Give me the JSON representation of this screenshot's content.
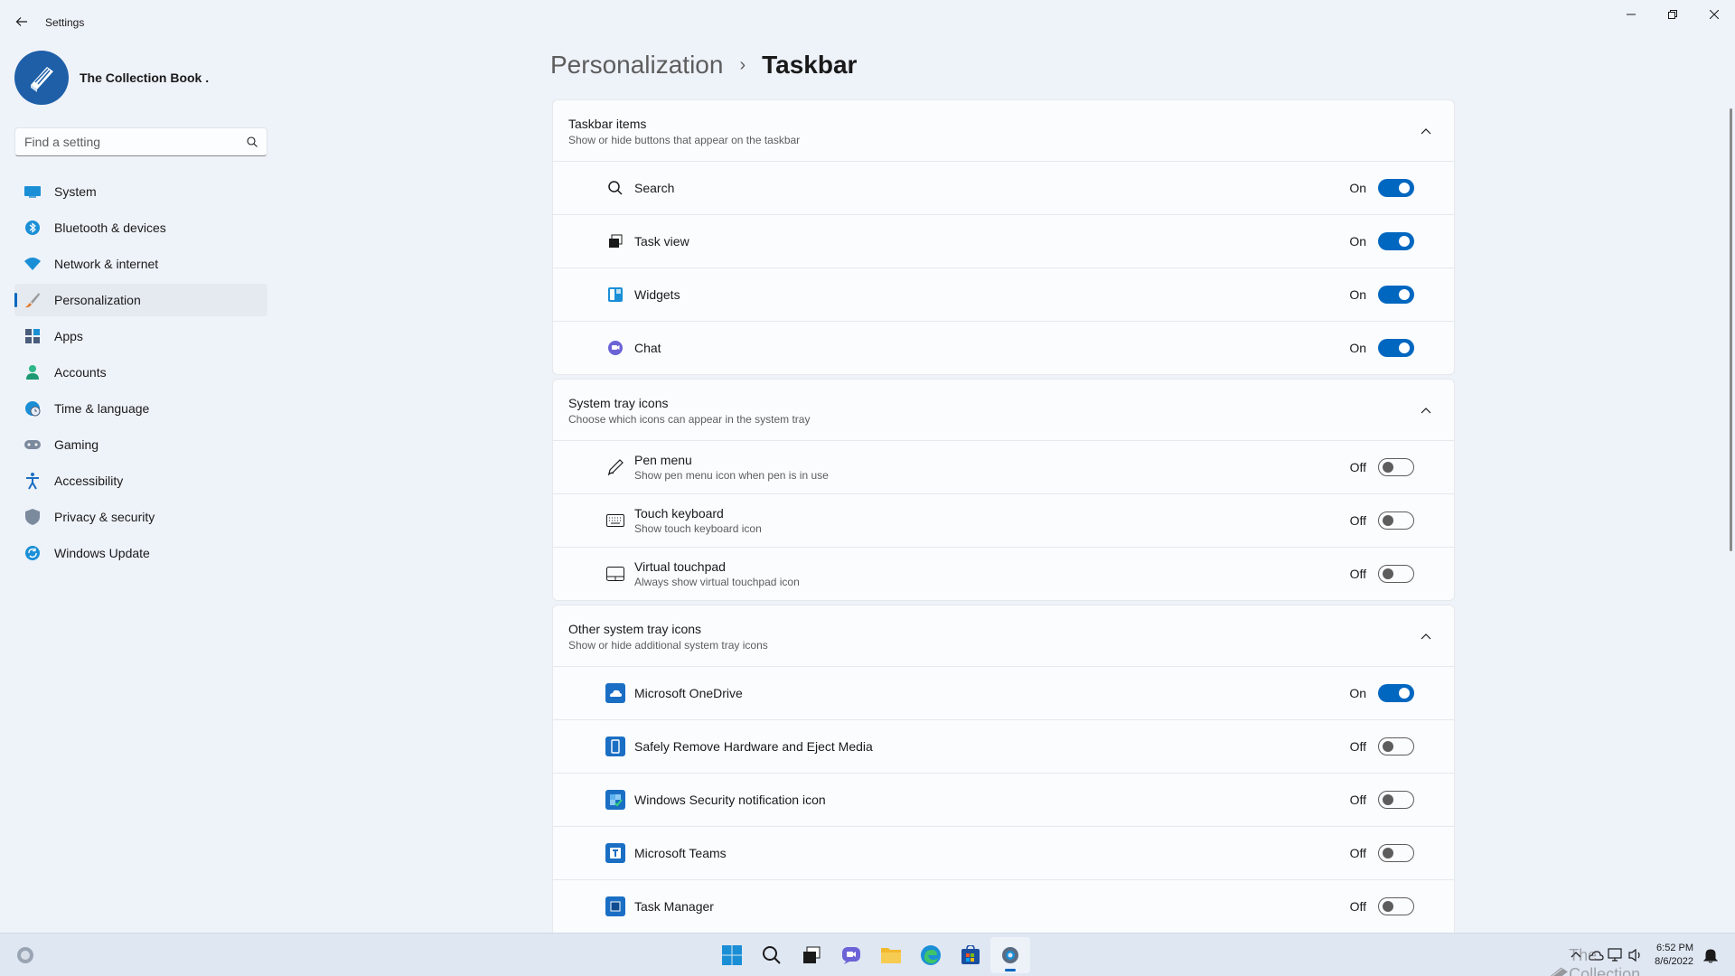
{
  "window": {
    "title": "Settings"
  },
  "profile": {
    "name": "The Collection Book ."
  },
  "search": {
    "placeholder": "Find a setting"
  },
  "sidebar": {
    "items": [
      {
        "label": "System",
        "icon": "monitor-icon"
      },
      {
        "label": "Bluetooth & devices",
        "icon": "bluetooth-icon"
      },
      {
        "label": "Network & internet",
        "icon": "wifi-icon"
      },
      {
        "label": "Personalization",
        "icon": "brush-icon",
        "active": true
      },
      {
        "label": "Apps",
        "icon": "apps-icon"
      },
      {
        "label": "Accounts",
        "icon": "person-icon"
      },
      {
        "label": "Time & language",
        "icon": "globe-clock-icon"
      },
      {
        "label": "Gaming",
        "icon": "gamepad-icon"
      },
      {
        "label": "Accessibility",
        "icon": "accessibility-icon"
      },
      {
        "label": "Privacy & security",
        "icon": "shield-icon"
      },
      {
        "label": "Windows Update",
        "icon": "update-icon"
      }
    ]
  },
  "breadcrumb": {
    "parent": "Personalization",
    "separator": "›",
    "current": "Taskbar"
  },
  "sections": [
    {
      "title": "Taskbar items",
      "subtitle": "Show or hide buttons that appear on the taskbar",
      "rows": [
        {
          "label": "Search",
          "desc": "",
          "state": "On",
          "on": true,
          "icon": "search-icon"
        },
        {
          "label": "Task view",
          "desc": "",
          "state": "On",
          "on": true,
          "icon": "task-view-icon"
        },
        {
          "label": "Widgets",
          "desc": "",
          "state": "On",
          "on": true,
          "icon": "widgets-icon"
        },
        {
          "label": "Chat",
          "desc": "",
          "state": "On",
          "on": true,
          "icon": "chat-icon"
        }
      ]
    },
    {
      "title": "System tray icons",
      "subtitle": "Choose which icons can appear in the system tray",
      "rows": [
        {
          "label": "Pen menu",
          "desc": "Show pen menu icon when pen is in use",
          "state": "Off",
          "on": false,
          "icon": "pen-icon"
        },
        {
          "label": "Touch keyboard",
          "desc": "Show touch keyboard icon",
          "state": "Off",
          "on": false,
          "icon": "keyboard-icon"
        },
        {
          "label": "Virtual touchpad",
          "desc": "Always show virtual touchpad icon",
          "state": "Off",
          "on": false,
          "icon": "touchpad-icon"
        }
      ]
    },
    {
      "title": "Other system tray icons",
      "subtitle": "Show or hide additional system tray icons",
      "rows": [
        {
          "label": "Microsoft OneDrive",
          "desc": "",
          "state": "On",
          "on": true,
          "icon": "onedrive-icon"
        },
        {
          "label": "Safely Remove Hardware and Eject Media",
          "desc": "",
          "state": "Off",
          "on": false,
          "icon": "usb-icon"
        },
        {
          "label": "Windows Security notification icon",
          "desc": "",
          "state": "Off",
          "on": false,
          "icon": "security-icon"
        },
        {
          "label": "Microsoft Teams",
          "desc": "",
          "state": "Off",
          "on": false,
          "icon": "teams-icon"
        },
        {
          "label": "Task Manager",
          "desc": "",
          "state": "Off",
          "on": false,
          "icon": "task-manager-icon"
        }
      ]
    }
  ],
  "taskbar": {
    "apps": [
      "start-icon",
      "search-icon",
      "task-view-icon",
      "chat-icon",
      "file-explorer-icon",
      "edge-icon",
      "store-icon",
      "settings-icon"
    ],
    "active_app": "settings-icon",
    "clock_time": "6:52 PM",
    "clock_date": "8/6/2022",
    "watermark": "The Collection Book"
  },
  "colors": {
    "accent": "#0067c0",
    "background": "#eef2f9",
    "card": "#fbfcfe"
  }
}
